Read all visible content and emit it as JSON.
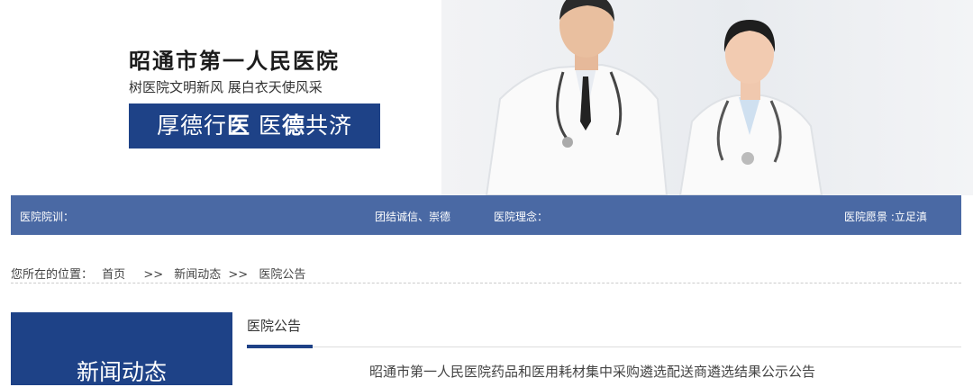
{
  "header": {
    "hospital_name": "昭通市第一人民医院",
    "slogan": "树医院文明新风 展白衣天使风采",
    "motto_part1": "厚德行",
    "motto_part2": "医",
    "motto_part3": "医",
    "motto_part4": "德",
    "motto_part5": "共济"
  },
  "info_bar": {
    "motto_label": "医院院训：",
    "motto_value": "团结诚信、崇德",
    "concept_label": "医院理念：",
    "vision_label": "医院愿景 :立足",
    "vision_partial": "滇"
  },
  "breadcrumb": {
    "prefix": "您所在的位置：",
    "home": "首页",
    "sep1": ">>",
    "level2": "新闻动态",
    "sep2": ">>",
    "level3": "医院公告"
  },
  "sidebar": {
    "title": "新闻动态"
  },
  "main": {
    "section_title": "医院公告",
    "articles": [
      {
        "title": "昭通市第一人民医院药品和医用耗材集中采购遴选配送商遴选结果公示公告"
      }
    ]
  },
  "colors": {
    "brand_blue": "#1e4287",
    "bar_blue": "#4a69a4"
  }
}
